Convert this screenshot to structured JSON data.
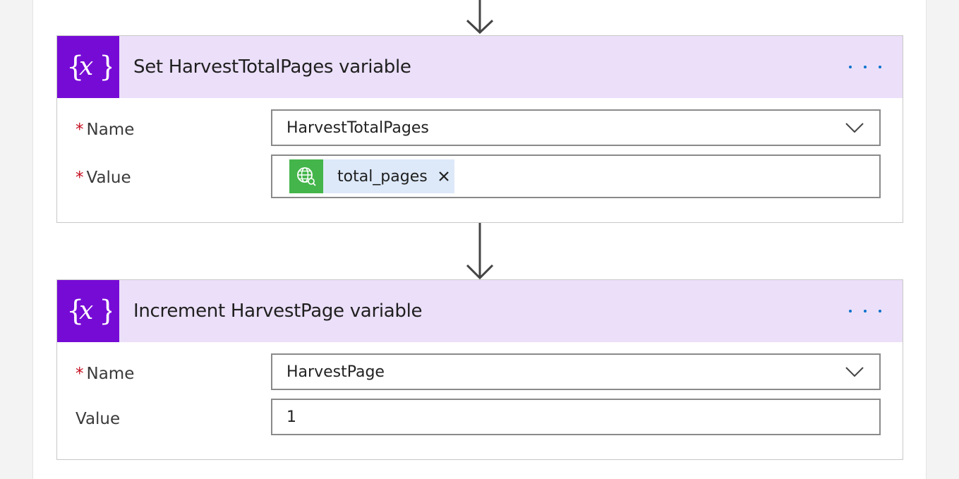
{
  "actions": [
    {
      "title": "Set HarvestTotalPages variable",
      "icon": "variable-icon",
      "fields": [
        {
          "label": "Name",
          "required": true,
          "value": "HarvestTotalPages",
          "type": "dropdown"
        },
        {
          "label": "Value",
          "required": true,
          "token": "total_pages",
          "type": "token",
          "token_icon": "http-globe-icon"
        }
      ]
    },
    {
      "title": "Increment HarvestPage variable",
      "icon": "variable-icon",
      "fields": [
        {
          "label": "Name",
          "required": true,
          "value": "HarvestPage",
          "type": "dropdown"
        },
        {
          "label": "Value",
          "required": false,
          "value": "1",
          "type": "text"
        }
      ]
    }
  ],
  "required_marker": "*",
  "colors": {
    "header_bg": "#ebdff9",
    "icon_bg": "#770bd6",
    "accent": "#0b72cc",
    "token_icon_bg": "#43b54a",
    "token_bg": "#dde9f9",
    "required": "#c50f1f"
  }
}
